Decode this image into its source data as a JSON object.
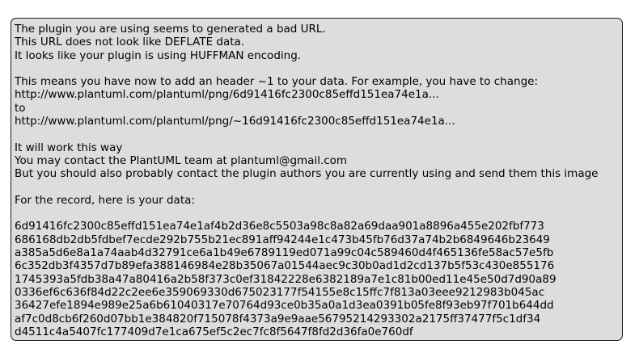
{
  "message": {
    "intro": [
      "The plugin you are using seems to generated a bad URL.",
      "This URL does not look like DEFLATE data.",
      "It looks like your plugin is using HUFFMAN encoding."
    ],
    "explanation": [
      "This means you have now to add an header ~1 to your data. For example, you have to change:",
      "http://www.plantuml.com/plantuml/png/6d91416fc2300c85effd151ea74e1a...",
      "to",
      "http://www.plantuml.com/plantuml/png/~16d91416fc2300c85effd151ea74e1a..."
    ],
    "contact": [
      "It will work this way",
      "You may contact the PlantUML team at plantuml@gmail.com",
      "But you should also probably contact the plugin authors you are currently using and send them this image"
    ],
    "record_label": "For the record, here is your data:",
    "data_lines": [
      "6d91416fc2300c85effd151ea74e1af4b2d36e8c5503a98c8a82a69daa901a8896a455e202fbf773",
      "686168db2db5fdbef7ecde292b755b21ec891aff94244e1c473b45fb76d37a74b2b6849646b23649",
      "a385a5d6e8a1a74aab4d32791ce6a1b49e6789119ed071a99c04c589460d4f465136fe58ac57e5fb",
      "6c352db3f4357d7b89efa388146984e28b35067a01544aec9c30b0ad1d2cd137b5f53c430e855176",
      "1745393a5fdb38a47a80416a2b58f373c0ef31842228e6382189a7e1c81b00ed11e45e50d7d90a89",
      "0336ef6c636f84d22c2ee6e359069330d675023177f54155e8c15ffc7f813a03eee9212983b045ac",
      "36427efe1894e989e25a6b61040317e70764d93ce0b35a0a1d3ea0391b05fe8f93eb97f701b644dd",
      "af7c0d8cb6f260d07bb1e384820f715078f4373a9e9aae56795214293302a2175ff37477f5c1df34",
      "d4511c4a5407fc177409d7e1ca675ef5c2ec7fc8f5647f8fd2d36fa0e760df"
    ]
  }
}
